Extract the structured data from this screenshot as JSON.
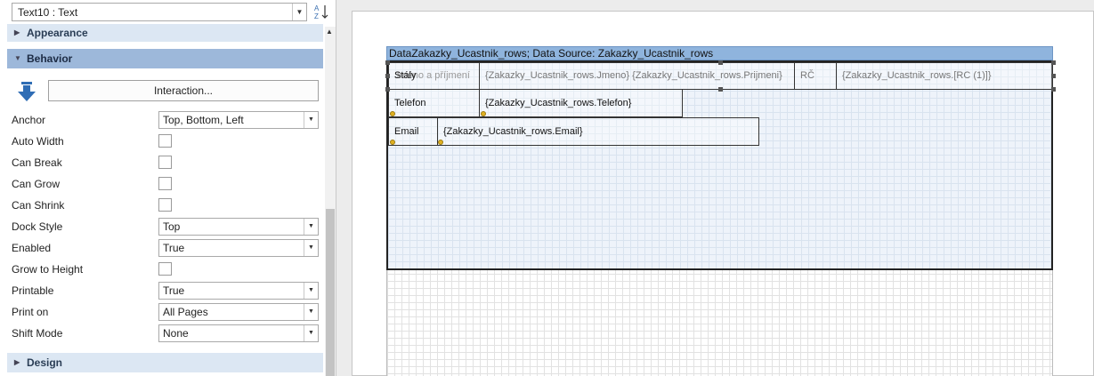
{
  "object_selector": {
    "value": "Text10 : Text"
  },
  "categories": {
    "appearance": "Appearance",
    "behavior": "Behavior",
    "design": "Design"
  },
  "interaction_button": "Interaction...",
  "properties": [
    {
      "label": "Anchor",
      "type": "select",
      "value": "Top, Bottom, Left"
    },
    {
      "label": "Auto Width",
      "type": "checkbox",
      "checked": false
    },
    {
      "label": "Can Break",
      "type": "checkbox",
      "checked": false
    },
    {
      "label": "Can Grow",
      "type": "checkbox",
      "checked": false
    },
    {
      "label": "Can Shrink",
      "type": "checkbox",
      "checked": false
    },
    {
      "label": "Dock Style",
      "type": "select",
      "value": "Top"
    },
    {
      "label": "Enabled",
      "type": "select",
      "value": "True"
    },
    {
      "label": "Grow to Height",
      "type": "checkbox",
      "checked": false
    },
    {
      "label": "Printable",
      "type": "select",
      "value": "True"
    },
    {
      "label": "Print on",
      "type": "select",
      "value": "All Pages"
    },
    {
      "label": "Shift Mode",
      "type": "select",
      "value": "None"
    }
  ],
  "designer": {
    "band_header": "DataZakazky_Ucastnik_rows; Data Source: Zakazky_Ucastnik_rows",
    "row1": {
      "label_overlap_a": "Stály",
      "label_overlap_b": "Jméno a příjmení",
      "name_field": "{Zakazky_Ucastnik_rows.Jmeno} {Zakazky_Ucastnik_rows.Prijmeni}",
      "rc_label": "RČ",
      "rc_field": "{Zakazky_Ucastnik_rows.[RC (1)]}"
    },
    "row2": {
      "label": "Telefon",
      "field": "{Zakazky_Ucastnik_rows.Telefon}"
    },
    "row3": {
      "label": "Email",
      "field": "{Zakazky_Ucastnik_rows.Email}"
    }
  },
  "colors": {
    "category_bg": "#dce7f3",
    "category_active": "#9db8da",
    "band_header": "#8fb4dd"
  }
}
